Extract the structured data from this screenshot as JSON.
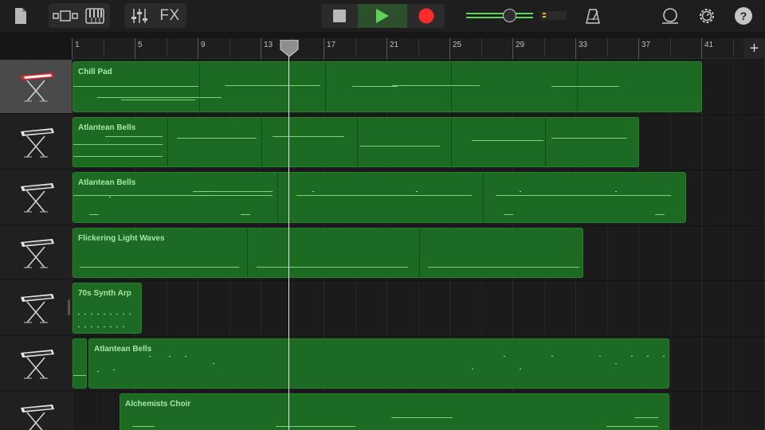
{
  "toolbar": {
    "fx_label": "FX",
    "accent_green": "#5fd35a",
    "record_red": "#ff2a2a",
    "icons": [
      "document-icon",
      "view-toggle-icon",
      "keyboard-icon",
      "mixer-icon",
      "stop-icon",
      "play-icon",
      "record-icon",
      "metronome-icon",
      "loop-icon",
      "settings-icon",
      "help-icon"
    ],
    "help_label": "?"
  },
  "ruler": {
    "bar_numbers": [
      "1",
      "5",
      "9",
      "13",
      "17",
      "21",
      "25",
      "29",
      "33",
      "37",
      "41"
    ],
    "add_label": "+"
  },
  "tracks": [
    {
      "instrument": "red-keyboard-icon",
      "selected": true,
      "regions": [
        {
          "name": "Chill Pad"
        }
      ]
    },
    {
      "instrument": "keyboard-stand-icon",
      "selected": false,
      "regions": [
        {
          "name": "Atlantean Bells"
        }
      ]
    },
    {
      "instrument": "keyboard-stand-icon",
      "selected": false,
      "regions": [
        {
          "name": "Atlantean Bells"
        }
      ]
    },
    {
      "instrument": "keyboard-stand-icon",
      "selected": false,
      "regions": [
        {
          "name": "Flickering Light Waves"
        }
      ]
    },
    {
      "instrument": "keyboard-stand-icon",
      "selected": false,
      "regions": [
        {
          "name": "70s Synth Arp"
        }
      ]
    },
    {
      "instrument": "keyboard-stand-icon",
      "selected": false,
      "regions": [
        {
          "name": ""
        },
        {
          "name": "Atlantean Bells"
        }
      ]
    },
    {
      "instrument": "keyboard-stand-icon",
      "selected": false,
      "regions": [
        {
          "name": "Alchemists Choir"
        }
      ]
    }
  ],
  "colors": {
    "region": "#1d6b23",
    "region_text": "#a8e6a6",
    "note": "#7fd27b"
  }
}
